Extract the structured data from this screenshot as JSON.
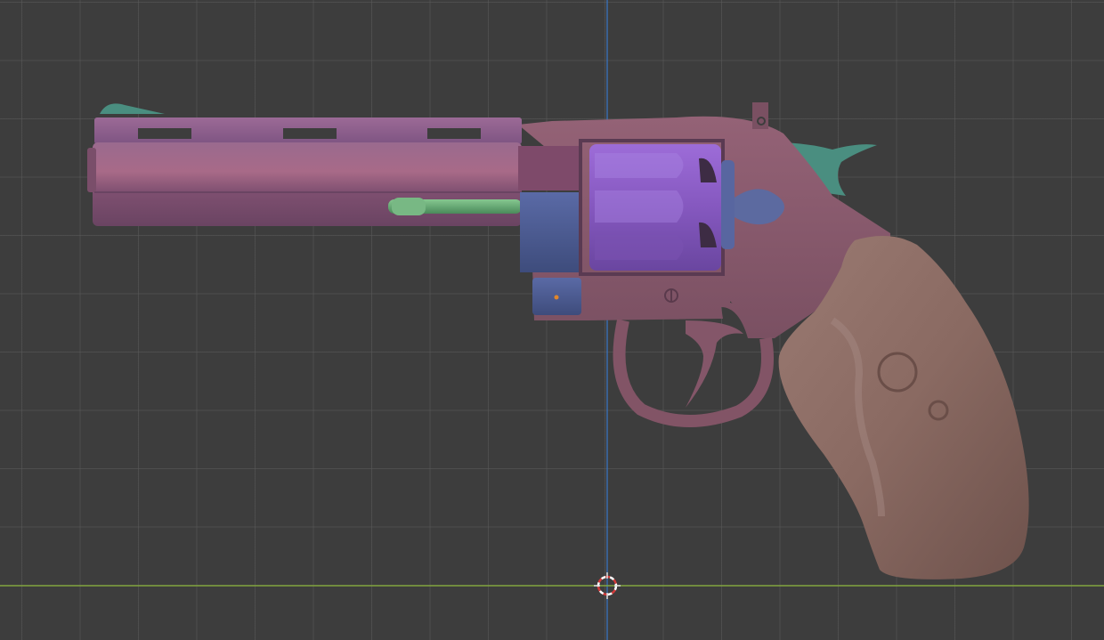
{
  "viewport": {
    "background_color": "#3d3d3d",
    "grid_color": "#5a5a5a",
    "x_axis_color": "#8ab43a",
    "z_axis_color": "#3a78c8"
  },
  "scene_object": {
    "icon": "revolver-model-icon",
    "colors": {
      "barrel": "#8a5a7e",
      "cylinder": "#8c5ec8",
      "frame": "#8a5a6e",
      "grip": "#8c6c64",
      "ejector_rod": "#5e9e6e",
      "hammer": "#4a8e80",
      "crane": "#4e5e90"
    }
  },
  "cursor_3d": {
    "icon": "3d-cursor-icon"
  }
}
